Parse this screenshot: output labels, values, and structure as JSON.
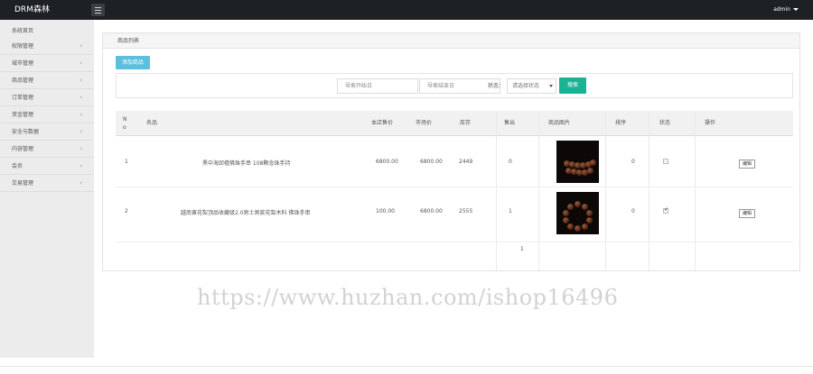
{
  "brand": "DRM森林",
  "user": "admin",
  "sidebar": {
    "home": "系统首页",
    "items": [
      {
        "label": "权限管理"
      },
      {
        "label": "城市管理"
      },
      {
        "label": "商品管理"
      },
      {
        "label": "订单管理"
      },
      {
        "label": "资金管理"
      },
      {
        "label": "安全与数据"
      },
      {
        "label": "内容管理"
      },
      {
        "label": "会员"
      },
      {
        "label": "交易管理"
      }
    ]
  },
  "panel": {
    "title": "商品列表",
    "add_button": "添加商品"
  },
  "filter": {
    "start_placeholder": "导索开始日",
    "end_placeholder": "导索结束日",
    "status_label": "状态：",
    "status_selected": "请选择状态",
    "search_button": "搜索"
  },
  "table": {
    "headers": {
      "no": "N o",
      "name": "名品",
      "market_price": "本店售价",
      "price": "市场价",
      "stock": "库存",
      "sold": "售出",
      "image": "商品图片",
      "sort": "排序",
      "status": "状态",
      "action": "操作"
    },
    "rows": [
      {
        "no": "1",
        "name": "黑中海邱檀佛珠手串 108颗念珠手持",
        "market_price": "6800.00",
        "price": "6800.00",
        "stock": "2449",
        "sold": "0",
        "sort": "0",
        "status_on": false,
        "edit": "编辑"
      },
      {
        "no": "2",
        "name": "越南黄花梨顶品收藏级2.0男士男款花梨木料 佛珠手串",
        "market_price": "100.00",
        "price": "6800.00",
        "stock": "2555",
        "sold": "1",
        "sort": "0",
        "status_on": true,
        "edit": "编辑"
      }
    ],
    "overflow_sold": "1"
  },
  "watermark": "https://www.huzhan.com/ishop16496"
}
